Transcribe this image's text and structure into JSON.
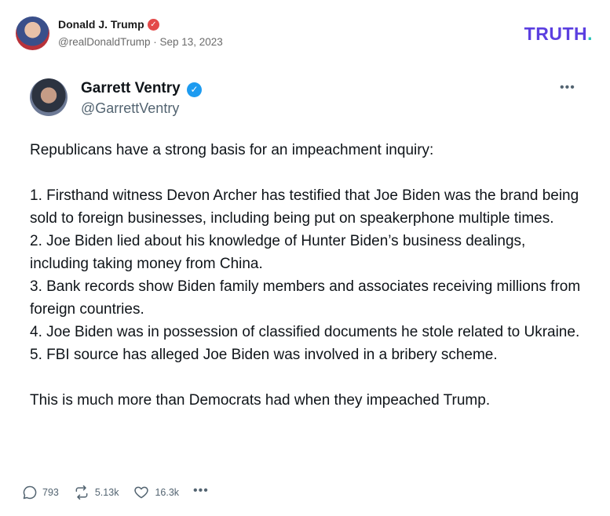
{
  "post": {
    "author_name": "Donald J. Trump",
    "author_meta": "@realDonaldTrump · Sep 13, 2023",
    "brand_logo": "TRUTH",
    "brand_dot": "."
  },
  "quoted": {
    "name": "Garrett Ventry",
    "handle": "@GarrettVentry",
    "more": "•••",
    "paragraphs": [
      "Republicans have a strong basis for an impeachment inquiry:",
      "",
      "1.  Firsthand witness Devon Archer has testified that Joe Biden was the brand being sold to foreign businesses, including being put on speakerphone multiple times.",
      "2. Joe Biden lied about his knowledge of Hunter Biden’s business dealings, including taking money from China.",
      "3. Bank records show Biden family members and associates receiving millions from foreign countries.",
      "4. Joe Biden was in possession of classified documents he stole related to Ukraine.",
      "5. FBI source has alleged Joe Biden was involved in a bribery scheme.",
      "",
      "This is much more than Democrats had when they impeached Trump."
    ]
  },
  "actions": {
    "replies": "793",
    "retruths": "5.13k",
    "likes": "16.3k",
    "more": "•••"
  },
  "colors": {
    "brand": "#5b3fe0",
    "brand_dot": "#27c4b8",
    "verified_main": "#e34a4a",
    "verified_blue": "#1d9bf0",
    "muted": "#536471"
  }
}
